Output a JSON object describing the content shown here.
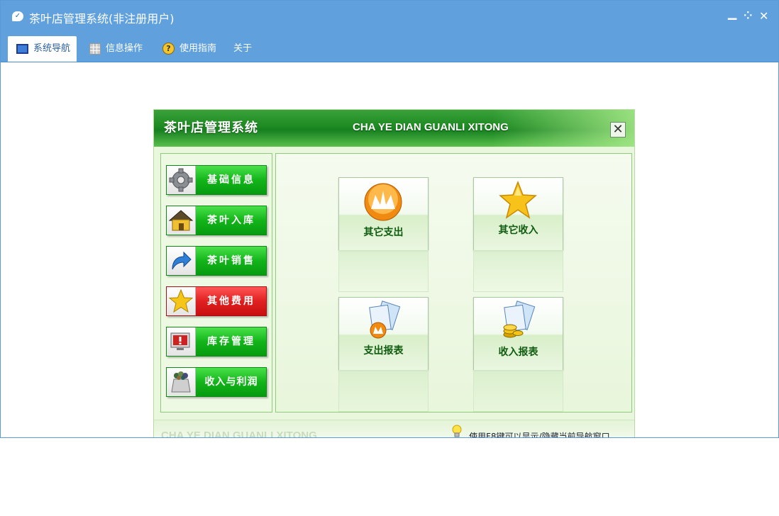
{
  "window": {
    "title": "茶叶店管理系统(非注册用户)",
    "controls": {
      "minimize": "▁",
      "restore": "⁘",
      "close": "✕"
    }
  },
  "menu": {
    "tabs": [
      {
        "label": "系统导航",
        "icon": "monitor-icon",
        "active": true
      },
      {
        "label": "信息操作",
        "icon": "grid-icon",
        "active": false
      },
      {
        "label": "使用指南",
        "icon": "help-icon",
        "active": false
      },
      {
        "label": "关于",
        "icon": "",
        "active": false
      }
    ]
  },
  "panel": {
    "title": "茶叶店管理系统",
    "subtitle": "CHA YE DIAN GUANLI XITONG",
    "close": "✕",
    "nav": [
      {
        "label": "基础信息",
        "icon": "gear-icon",
        "color": "green"
      },
      {
        "label": "茶叶入库",
        "icon": "house-icon",
        "color": "green"
      },
      {
        "label": "茶叶销售",
        "icon": "arrow-icon",
        "color": "green"
      },
      {
        "label": "其他费用",
        "icon": "star-icon",
        "color": "red"
      },
      {
        "label": "库存管理",
        "icon": "alert-monitor-icon",
        "color": "green"
      },
      {
        "label": "收入与利润",
        "icon": "coin-bag-icon",
        "color": "green"
      }
    ],
    "tiles": [
      {
        "label": "其它支出",
        "icon": "flame-icon"
      },
      {
        "label": "其它收入",
        "icon": "star-icon"
      },
      {
        "label": "支出报表",
        "icon": "report-flame-icon"
      },
      {
        "label": "收入报表",
        "icon": "report-coins-icon"
      }
    ],
    "footer": {
      "left": "CHA YE DIAN GUANLI XITONG",
      "right": "使用F8键可以显示/隐藏当前导航窗口"
    }
  },
  "colors": {
    "titlebar": "#5fa0dd",
    "nav_green": "#13b51a",
    "nav_red": "#e02020",
    "header_green": "#1e8a22"
  }
}
